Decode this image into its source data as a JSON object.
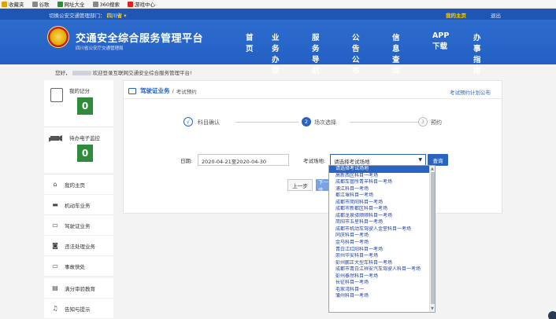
{
  "bookmarks": [
    {
      "label": "收藏夹",
      "icon": "star-icon",
      "color": "#e0a000"
    },
    {
      "label": "谷歌",
      "icon": "page-icon",
      "color": "#888888"
    },
    {
      "label": "网址大全",
      "icon": "globe-icon",
      "color": "#2e8b3a"
    },
    {
      "label": "360搜索",
      "icon": "page-icon",
      "color": "#888888"
    },
    {
      "label": "游戏中心",
      "icon": "game-icon",
      "color": "#d9261c"
    }
  ],
  "topbar": {
    "city_switch": "切换公安交通管理部门：",
    "city_name": "四川省 ▾",
    "my_home": "我的主页",
    "logout": "退出"
  },
  "site": {
    "title": "交通安全综合服务管理平台",
    "subtitle": "四川省公安厅交通管理局"
  },
  "nav": [
    "首页",
    "业务办理",
    "服务导航",
    "公告公布",
    "信息查询",
    "APP下载",
    "办事指南"
  ],
  "welcome": {
    "prefix": "您好，",
    "suffix": "欢迎登录互联网交通安全综合服务管理平台!"
  },
  "sidebar": {
    "stats": [
      {
        "label": "我的记分",
        "value": "0",
        "icon": "document-icon"
      },
      {
        "label": "待办电子监控",
        "value": "0",
        "icon": "camera-icon"
      }
    ],
    "items": [
      {
        "label": "我的主页",
        "icon": "home-icon",
        "glyph": "⌂"
      },
      {
        "label": "机动车业务",
        "icon": "car-icon",
        "glyph": "▬"
      },
      {
        "label": "驾驶证业务",
        "icon": "license-icon",
        "glyph": "▭"
      },
      {
        "label": "违法处理业务",
        "icon": "camera-icon",
        "glyph": "◙"
      },
      {
        "label": "事故快处",
        "icon": "accident-icon",
        "glyph": "▭"
      },
      {
        "label": "满分审验教育",
        "icon": "education-icon",
        "glyph": "▤"
      },
      {
        "label": "告知与提示",
        "icon": "bell-icon",
        "glyph": "♫"
      }
    ]
  },
  "main": {
    "crumb_section": "驾驶证业务",
    "crumb_sep": " / ",
    "crumb_page": "考试预约",
    "plan_link": "考试预约计划公布",
    "steps": [
      {
        "num": "√",
        "label": "科目确认"
      },
      {
        "num": "2",
        "label": "场次选择"
      },
      {
        "num": "3",
        "label": "预约"
      }
    ],
    "date_label": "日期:",
    "date_value": "2020-04-21至2020-04-30",
    "venue_label": "考试场地:",
    "venue_placeholder": "请选择考试场地",
    "query_button": "查询",
    "prev_button": "上一步",
    "next_button": "下一步"
  },
  "dropdown_options": [
    "请选择考试场地",
    "高新西区科目一考场",
    "成都车管所青羊科目一考场",
    "浦江科目一考场",
    "都江堰科目一考场",
    "成都市简阳科目一考场",
    "成都市新都区科目一考场",
    "成都龙泉驿顺顺科目一考场",
    "简阳市五星科目一考场",
    "成都市机动车驾驶人金堂科目一考场",
    "同庆科目一考场",
    "金马科目一考场",
    "青白江红阳科目一考场",
    "崇州华安科目一考场",
    "彭州鹏正大型车科目一考场",
    "成都市青白江祥安汽车驾驶人科目一考场",
    "彭州泰然科目一考场",
    "长征科目一考场",
    "毛家湾科目一",
    "蒲州科目一考场"
  ]
}
